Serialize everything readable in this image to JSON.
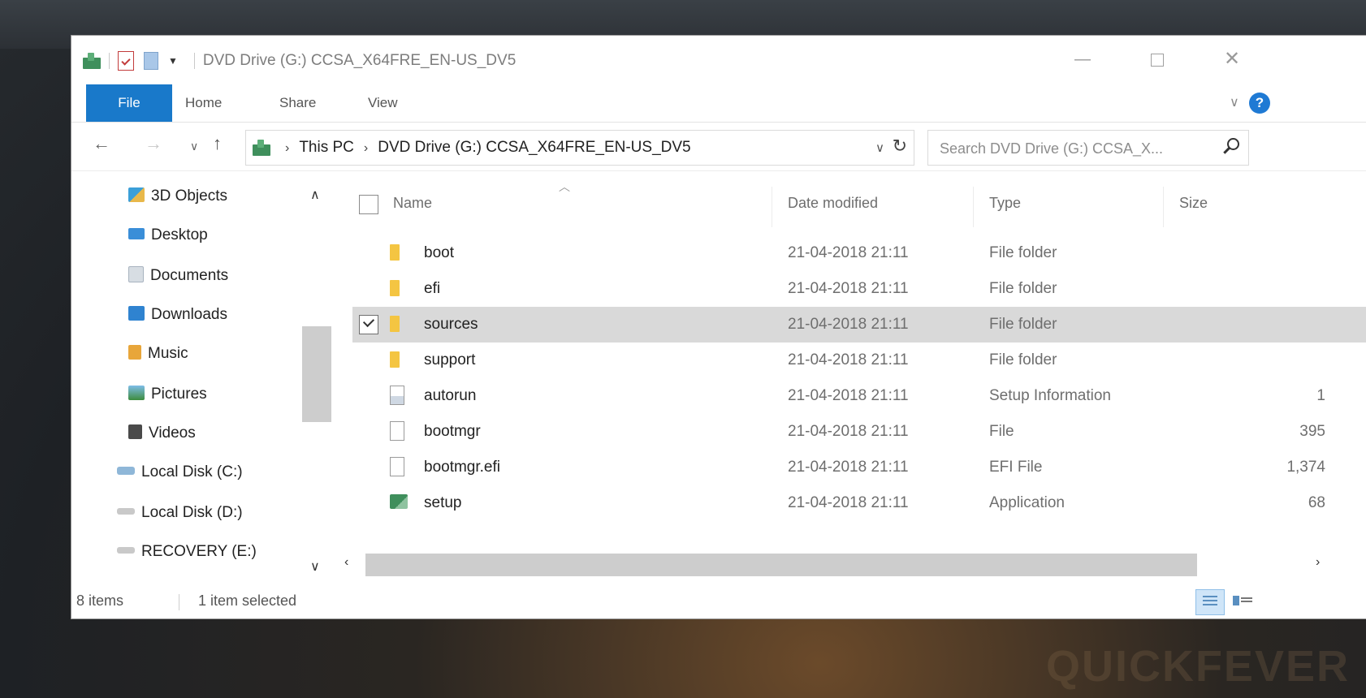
{
  "window": {
    "title": "DVD Drive (G:) CCSA_X64FRE_EN-US_DV5",
    "min_glyph": "—",
    "close_glyph": "✕"
  },
  "ribbon": {
    "tabs": [
      "File",
      "Home",
      "Share",
      "View"
    ],
    "help_glyph": "?"
  },
  "address": {
    "crumbs": [
      "This PC",
      "DVD Drive (G:) CCSA_X64FRE_EN-US_DV5"
    ],
    "search_placeholder": "Search DVD Drive (G:) CCSA_X..."
  },
  "nav_pane": {
    "items": [
      {
        "label": "3D Objects",
        "icon": "3d-objects-icon"
      },
      {
        "label": "Desktop",
        "icon": "desktop-icon"
      },
      {
        "label": "Documents",
        "icon": "documents-icon"
      },
      {
        "label": "Downloads",
        "icon": "downloads-icon"
      },
      {
        "label": "Music",
        "icon": "music-icon"
      },
      {
        "label": "Pictures",
        "icon": "pictures-icon"
      },
      {
        "label": "Videos",
        "icon": "videos-icon"
      },
      {
        "label": "Local Disk (C:)",
        "icon": "drive-icon"
      },
      {
        "label": "Local Disk (D:)",
        "icon": "drive-icon"
      },
      {
        "label": "RECOVERY (E:)",
        "icon": "drive-icon"
      }
    ]
  },
  "columns": {
    "name": "Name",
    "date": "Date modified",
    "type": "Type",
    "size": "Size"
  },
  "files": [
    {
      "name": "boot",
      "date": "21-04-2018 21:11",
      "type": "File folder",
      "size": "",
      "icon": "folder-icon",
      "selected": false
    },
    {
      "name": "efi",
      "date": "21-04-2018 21:11",
      "type": "File folder",
      "size": "",
      "icon": "folder-icon",
      "selected": false
    },
    {
      "name": "sources",
      "date": "21-04-2018 21:11",
      "type": "File folder",
      "size": "",
      "icon": "folder-icon",
      "selected": true
    },
    {
      "name": "support",
      "date": "21-04-2018 21:11",
      "type": "File folder",
      "size": "",
      "icon": "folder-icon",
      "selected": false
    },
    {
      "name": "autorun",
      "date": "21-04-2018 21:11",
      "type": "Setup Information",
      "size": "1",
      "icon": "setup-information-icon",
      "selected": false
    },
    {
      "name": "bootmgr",
      "date": "21-04-2018 21:11",
      "type": "File",
      "size": "395",
      "icon": "file-icon",
      "selected": false
    },
    {
      "name": "bootmgr.efi",
      "date": "21-04-2018 21:11",
      "type": "EFI File",
      "size": "1,374",
      "icon": "file-icon",
      "selected": false
    },
    {
      "name": "setup",
      "date": "21-04-2018 21:11",
      "type": "Application",
      "size": "68",
      "icon": "application-icon",
      "selected": false
    }
  ],
  "status": {
    "count": "8 items",
    "selection": "1 item selected"
  },
  "watermark": "QUICKFEVER",
  "colors": {
    "accent": "#1979ca",
    "selected_row": "#d9d9d9",
    "folder": "#f4c542"
  }
}
